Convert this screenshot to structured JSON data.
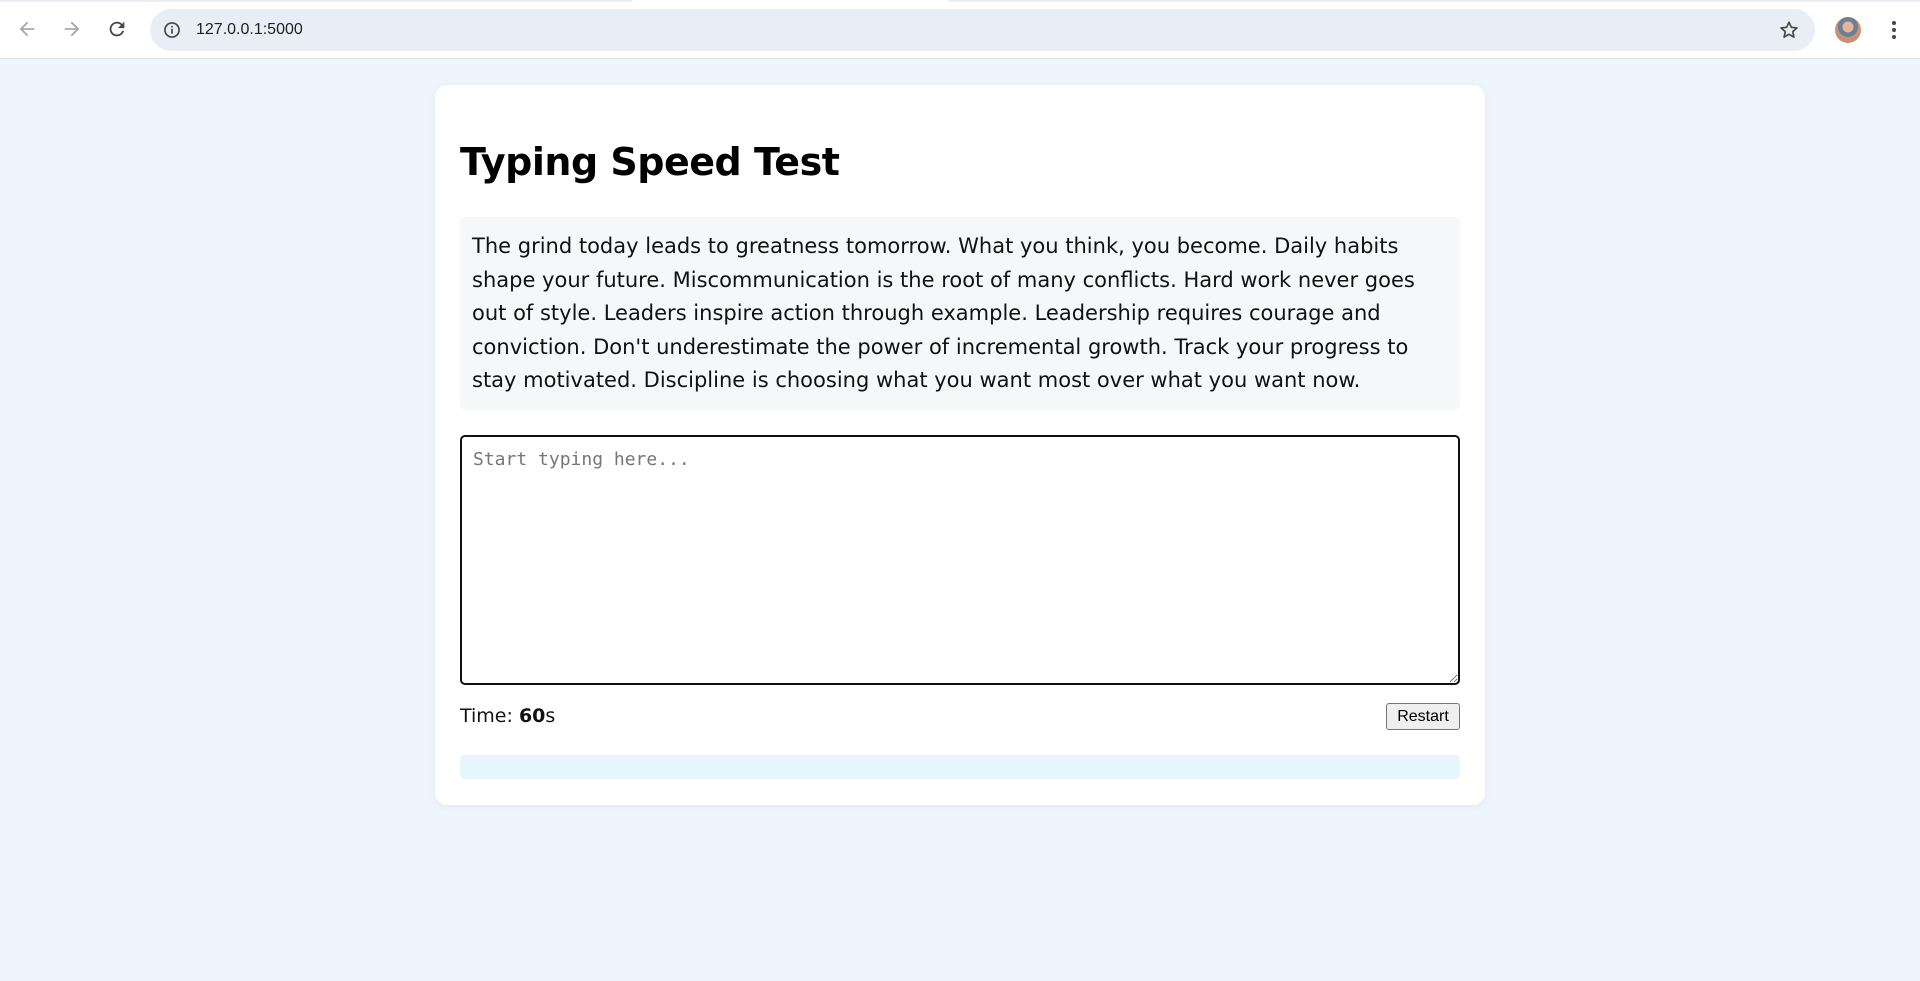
{
  "browser": {
    "url": "127.0.0.1:5000",
    "icons": [
      "back-icon",
      "forward-icon",
      "reload-icon",
      "site-info-icon",
      "bookmark-star-icon",
      "profile-avatar",
      "more-menu-icon"
    ]
  },
  "page": {
    "title": "Typing Speed Test",
    "passage": "The grind today leads to greatness tomorrow. What you think, you become. Daily habits shape your future. Miscommunication is the root of many conflicts. Hard work never goes out of style. Leaders inspire action through example. Leadership requires courage and conviction. Don't underestimate the power of incremental growth. Track your progress to stay motivated. Discipline is choosing what you want most over what you want now.",
    "input": {
      "value": "",
      "placeholder": "Start typing here..."
    },
    "timer": {
      "label": "Time: ",
      "value": "60",
      "unit": "s"
    },
    "restart_label": "Restart",
    "result_text": ""
  },
  "colors": {
    "page_background": "#eff5fc",
    "card_background": "#ffffff",
    "passage_background": "#f5f7f9",
    "result_background": "#e6f6fc"
  }
}
